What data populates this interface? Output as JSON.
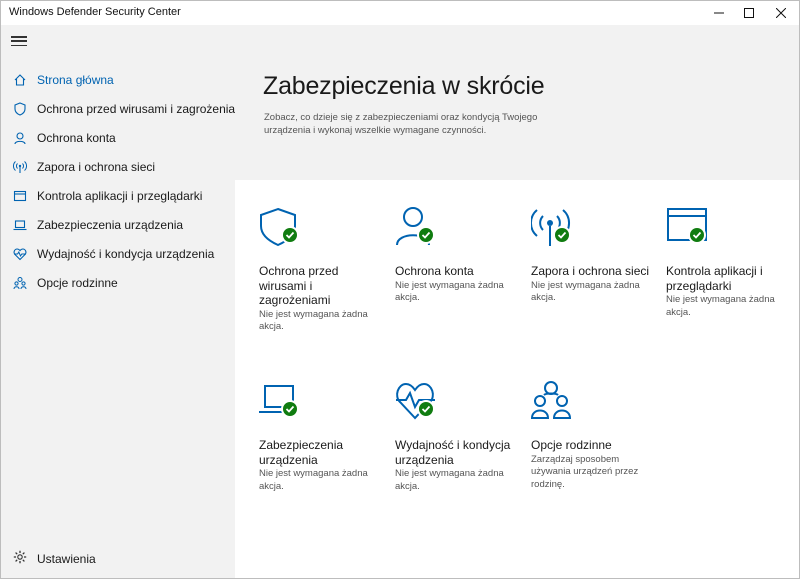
{
  "window": {
    "title": "Windows Defender Security Center"
  },
  "sidebar": {
    "items": [
      {
        "label": "Strona główna",
        "icon": "home-icon",
        "active": true
      },
      {
        "label": "Ochrona przed wirusami i zagrożeniami",
        "icon": "shield-icon",
        "active": false
      },
      {
        "label": "Ochrona konta",
        "icon": "person-icon",
        "active": false
      },
      {
        "label": "Zapora i ochrona sieci",
        "icon": "wireless-icon",
        "active": false
      },
      {
        "label": "Kontrola aplikacji i przeglądarki",
        "icon": "browser-window-icon",
        "active": false
      },
      {
        "label": "Zabezpieczenia urządzenia",
        "icon": "laptop-icon",
        "active": false
      },
      {
        "label": "Wydajność i kondycja urządzenia",
        "icon": "heart-pulse-icon",
        "active": false
      },
      {
        "label": "Opcje rodzinne",
        "icon": "family-icon",
        "active": false
      }
    ],
    "settings_label": "Ustawienia"
  },
  "main": {
    "title": "Zabezpieczenia w skrócie",
    "description": "Zobacz, co dzieje się z zabezpieczeniami oraz kondycją Twojego urządzenia i wykonaj wszelkie wymagane czynności.",
    "tiles": [
      {
        "title": "Ochrona przed wirusami i zagrożeniami",
        "status": "Nie jest wymagana żadna akcja.",
        "icon": "shield-icon",
        "ok": true
      },
      {
        "title": "Ochrona konta",
        "status": "Nie jest wymagana żadna akcja.",
        "icon": "person-icon",
        "ok": true
      },
      {
        "title": "Zapora i ochrona sieci",
        "status": "Nie jest wymagana żadna akcja.",
        "icon": "wireless-icon",
        "ok": true
      },
      {
        "title": "Kontrola aplikacji i przeglądarki",
        "status": "Nie jest wymagana żadna akcja.",
        "icon": "browser-window-icon",
        "ok": true
      },
      {
        "title": "Zabezpieczenia urządzenia",
        "status": "Nie jest wymagana żadna akcja.",
        "icon": "laptop-icon",
        "ok": true
      },
      {
        "title": "Wydajność i kondycja urządzenia",
        "status": "Nie jest wymagana żadna akcja.",
        "icon": "heart-pulse-icon",
        "ok": true
      },
      {
        "title": "Opcje rodzinne",
        "status": "Zarządzaj sposobem używania urządzeń przez rodzinę.",
        "icon": "family-icon",
        "ok": false
      }
    ]
  },
  "colors": {
    "accent": "#0063b1",
    "ok_green": "#107c10",
    "sidebar_bg": "#f2f2f2"
  }
}
